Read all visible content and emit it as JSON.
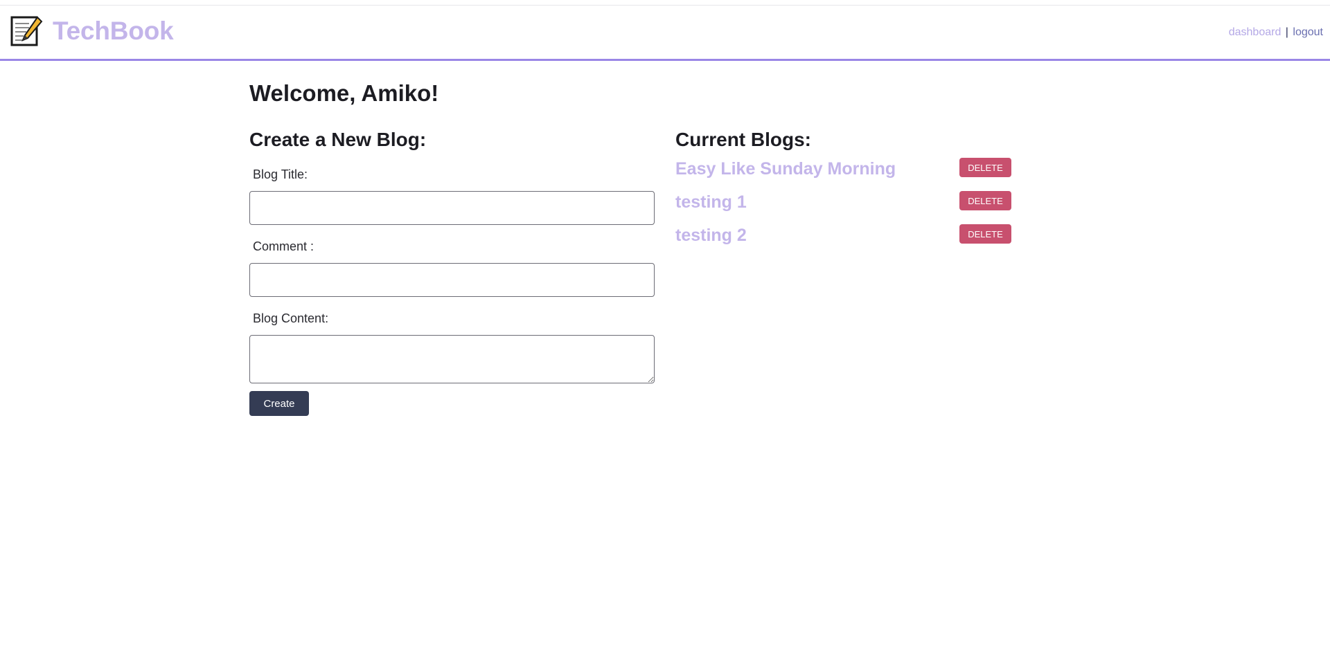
{
  "header": {
    "brand": "TechBook",
    "logo_icon": "notepad-pencil-icon",
    "nav": {
      "dashboard": "dashboard",
      "separator": "|",
      "logout": "logout"
    }
  },
  "main": {
    "welcome": "Welcome, Amiko!",
    "create": {
      "title": "Create a New Blog:",
      "blog_title_label": "Blog Title:",
      "blog_title_value": "",
      "comment_label": "Comment :",
      "comment_value": "",
      "content_label": "Blog Content:",
      "content_value": "",
      "create_button": "Create"
    },
    "current": {
      "title": "Current Blogs:",
      "blogs": [
        {
          "title": "Easy Like Sunday Morning",
          "delete_label": "DELETE"
        },
        {
          "title": "testing 1",
          "delete_label": "DELETE"
        },
        {
          "title": "testing 2",
          "delete_label": "DELETE"
        }
      ]
    }
  },
  "colors": {
    "accent": "#9a86e6",
    "brand": "#c3b5ea",
    "delete": "#c8506e",
    "primary_button": "#343c54"
  }
}
